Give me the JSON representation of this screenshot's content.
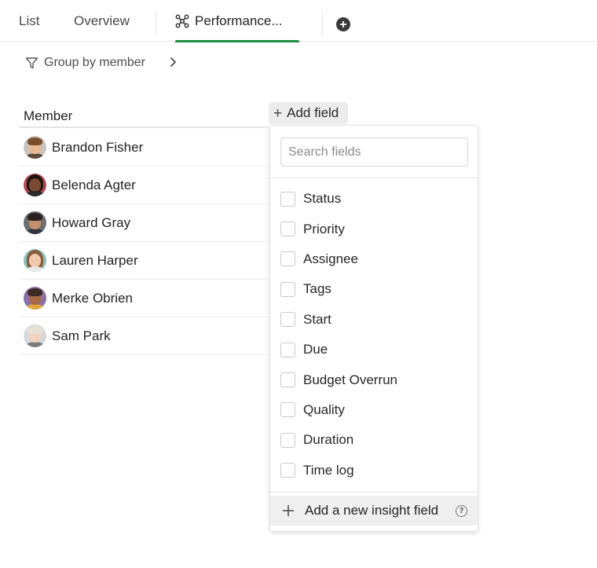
{
  "tabs": [
    {
      "label": "List"
    },
    {
      "label": "Overview"
    },
    {
      "label": "Performance..."
    }
  ],
  "toolbar": {
    "group_by_label": "Group by member"
  },
  "table": {
    "header": "Member",
    "rows": [
      {
        "name": "Brandon Fisher"
      },
      {
        "name": "Belenda Agter"
      },
      {
        "name": "Howard Gray"
      },
      {
        "name": "Lauren Harper"
      },
      {
        "name": "Merke Obrien"
      },
      {
        "name": "Sam Park"
      }
    ]
  },
  "add_field": {
    "label": "Add field"
  },
  "dropdown": {
    "search_placeholder": "Search fields",
    "fields": [
      {
        "label": "Status"
      },
      {
        "label": "Priority"
      },
      {
        "label": "Assignee"
      },
      {
        "label": "Tags"
      },
      {
        "label": "Start"
      },
      {
        "label": "Due"
      },
      {
        "label": "Budget Overrun"
      },
      {
        "label": "Quality"
      },
      {
        "label": "Duration"
      },
      {
        "label": "Time log"
      }
    ],
    "new_insight_label": "Add a new insight field"
  },
  "colors": {
    "accent": "#1e8e3e",
    "hover_bg": "#efefef"
  }
}
